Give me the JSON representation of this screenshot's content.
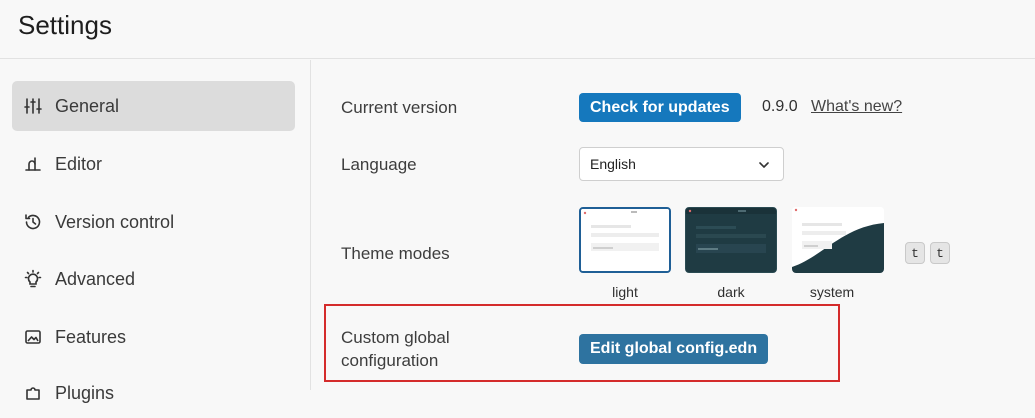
{
  "page": {
    "title": "Settings"
  },
  "sidebar": {
    "items": [
      {
        "label": "General",
        "icon": "sliders-icon",
        "active": true
      },
      {
        "label": "Editor",
        "icon": "editor-icon",
        "active": false
      },
      {
        "label": "Version control",
        "icon": "history-icon",
        "active": false
      },
      {
        "label": "Advanced",
        "icon": "lightbulb-icon",
        "active": false
      },
      {
        "label": "Features",
        "icon": "features-icon",
        "active": false
      },
      {
        "label": "Plugins",
        "icon": "puzzle-icon",
        "active": false
      }
    ]
  },
  "general": {
    "current_version_label": "Current version",
    "check_updates_label": "Check for updates",
    "version": "0.9.0",
    "whats_new_label": "What's new?",
    "language_label": "Language",
    "language_value": "English",
    "theme_modes_label": "Theme modes",
    "themes": [
      {
        "label": "light",
        "selected": true
      },
      {
        "label": "dark",
        "selected": false
      },
      {
        "label": "system",
        "selected": false
      }
    ],
    "shortcut_keys": [
      "t",
      "t"
    ],
    "custom_config_label_line1": "Custom global",
    "custom_config_label_line2": "configuration",
    "edit_config_label": "Edit global config.edn"
  },
  "colors": {
    "accent": "#1578bd",
    "accent_teal": "#2e73a0",
    "highlight": "#d42b2b",
    "dark_theme": "#1f3b43"
  }
}
